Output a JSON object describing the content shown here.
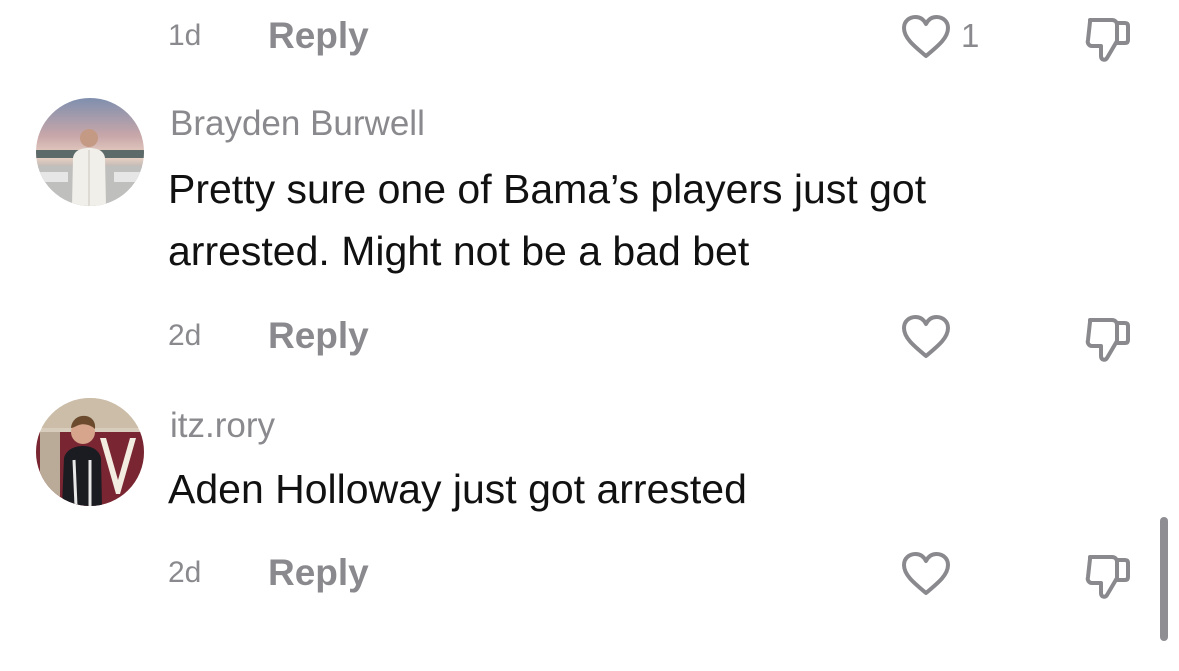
{
  "colors": {
    "meta_text": "#8a8a8e",
    "body_text": "#111111",
    "background": "#ffffff",
    "scrollbar": "#8e8e93"
  },
  "icons": {
    "like": "heart-outline-icon",
    "dislike": "thumbs-down-outline-icon"
  },
  "top_actions": {
    "time": "1d",
    "reply_label": "Reply",
    "like_count": "1"
  },
  "comments": [
    {
      "username": "Brayden Burwell",
      "text": "Pretty sure one of Bama’s players just got arrested. Might not be a bad bet",
      "time": "2d",
      "reply_label": "Reply"
    },
    {
      "username": "itz.rory",
      "text": "Aden Holloway just got arrested",
      "time": "2d",
      "reply_label": "Reply"
    }
  ]
}
